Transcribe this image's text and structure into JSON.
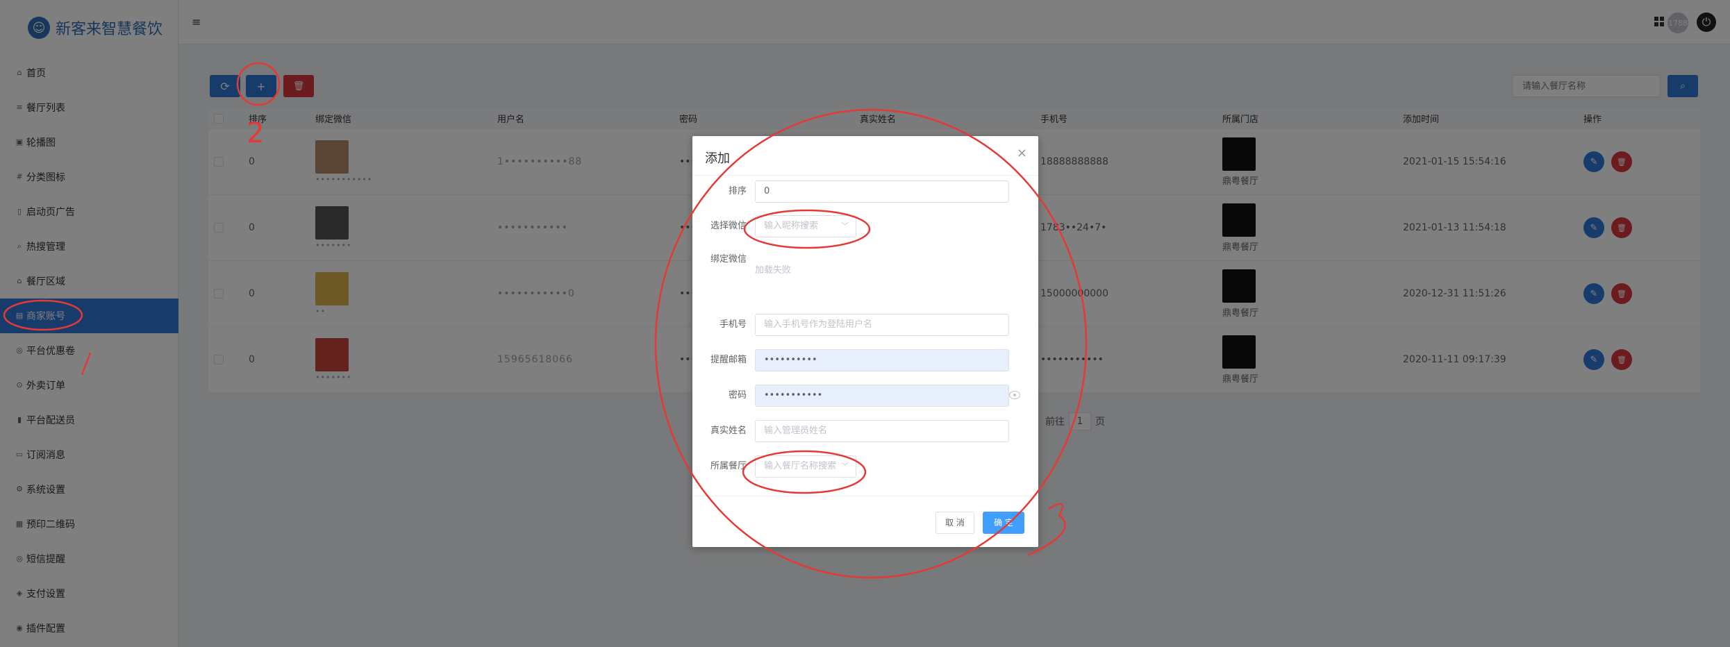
{
  "app": {
    "logo_text": "新客来智慧餐饮"
  },
  "sidebar": {
    "items": [
      {
        "label": "首页",
        "icon": "home-icon",
        "glyph": "⌂"
      },
      {
        "label": "餐厅列表",
        "icon": "list-icon",
        "glyph": "≡"
      },
      {
        "label": "轮播图",
        "icon": "image-icon",
        "glyph": "▣"
      },
      {
        "label": "分类图标",
        "icon": "category-icon",
        "glyph": "#"
      },
      {
        "label": "启动页广告",
        "icon": "ad-icon",
        "glyph": "▯"
      },
      {
        "label": "热搜管理",
        "icon": "search-icon",
        "glyph": "⌕"
      },
      {
        "label": "餐厅区域",
        "icon": "region-icon",
        "glyph": "⌂"
      },
      {
        "label": "商家账号",
        "icon": "account-icon",
        "glyph": "▤",
        "active": true
      },
      {
        "label": "平台优惠卷",
        "icon": "coupon-icon",
        "glyph": "◎"
      },
      {
        "label": "外卖订单",
        "icon": "order-icon",
        "glyph": "⊙"
      },
      {
        "label": "平台配送员",
        "icon": "delivery-icon",
        "glyph": "▮"
      },
      {
        "label": "订阅消息",
        "icon": "message-icon",
        "glyph": "▭"
      },
      {
        "label": "系统设置",
        "icon": "settings-icon",
        "glyph": "⚙"
      },
      {
        "label": "预印二维码",
        "icon": "qrcode-icon",
        "glyph": "▦"
      },
      {
        "label": "短信提醒",
        "icon": "sms-icon",
        "glyph": "◎"
      },
      {
        "label": "支付设置",
        "icon": "payment-icon",
        "glyph": "◈"
      },
      {
        "label": "插件配置",
        "icon": "plugin-icon",
        "glyph": "◉"
      }
    ]
  },
  "header": {
    "avatar_text": "1788"
  },
  "toolbar": {
    "refresh_glyph": "⟳",
    "add_glyph": "+",
    "delete_glyph": "🗑",
    "search_placeholder": "请输入餐厅名称",
    "search_glyph": "⌕"
  },
  "table": {
    "headers": [
      "排序",
      "绑定微信",
      "用户名",
      "密码",
      "真实姓名",
      "手机号",
      "所属门店",
      "添加时间",
      "操作"
    ],
    "rows": [
      {
        "sort": "0",
        "username": "1••••••••••88",
        "wechat_name": "•••••••••••",
        "phone": "18888888888",
        "store": "鼎粤餐厅",
        "time": "2021-01-15 15:54:16"
      },
      {
        "sort": "0",
        "username": "•••••••••••",
        "wechat_name": "•••••••",
        "phone": "1783••24•7•",
        "store": "鼎粤餐厅",
        "time": "2021-01-13 11:54:18"
      },
      {
        "sort": "0",
        "username": "•••••••••••0",
        "wechat_name": "••",
        "phone": "15000000000",
        "store": "鼎粤餐厅",
        "time": "2020-12-31 11:51:26"
      },
      {
        "sort": "0",
        "username": "15965618066",
        "wechat_name": "•••••••",
        "phone": "•••••••••••",
        "store": "鼎粤餐厅",
        "time": "2020-11-11 09:17:39"
      }
    ],
    "password_mask": "•••",
    "edit_glyph": "✎",
    "delete_glyph": "🗑"
  },
  "pager": {
    "goto_label": "前往",
    "page_value": "1",
    "page_suffix": "页"
  },
  "dialog": {
    "title": "添加",
    "close_glyph": "×",
    "fields": {
      "sort_label": "排序",
      "sort_value": "0",
      "wechat_select_label": "选择微信",
      "wechat_select_placeholder": "输入昵称搜索",
      "bound_wechat_label": "绑定微信",
      "bound_wechat_status": "加载失败",
      "phone_label": "手机号",
      "phone_placeholder": "输入手机号作为登陆用户名",
      "email_label": "提醒邮箱",
      "email_value": "••••••••••",
      "password_label": "密码",
      "password_value": "•••••••••••",
      "realname_label": "真实姓名",
      "realname_placeholder": "输入管理员姓名",
      "store_label": "所属餐厅",
      "store_placeholder": "输入餐厅名称搜索"
    },
    "cancel_label": "取 消",
    "confirm_label": "确 定"
  },
  "annotations": {
    "color": "#e53935",
    "mark_2": "2",
    "mark_3": "3"
  }
}
